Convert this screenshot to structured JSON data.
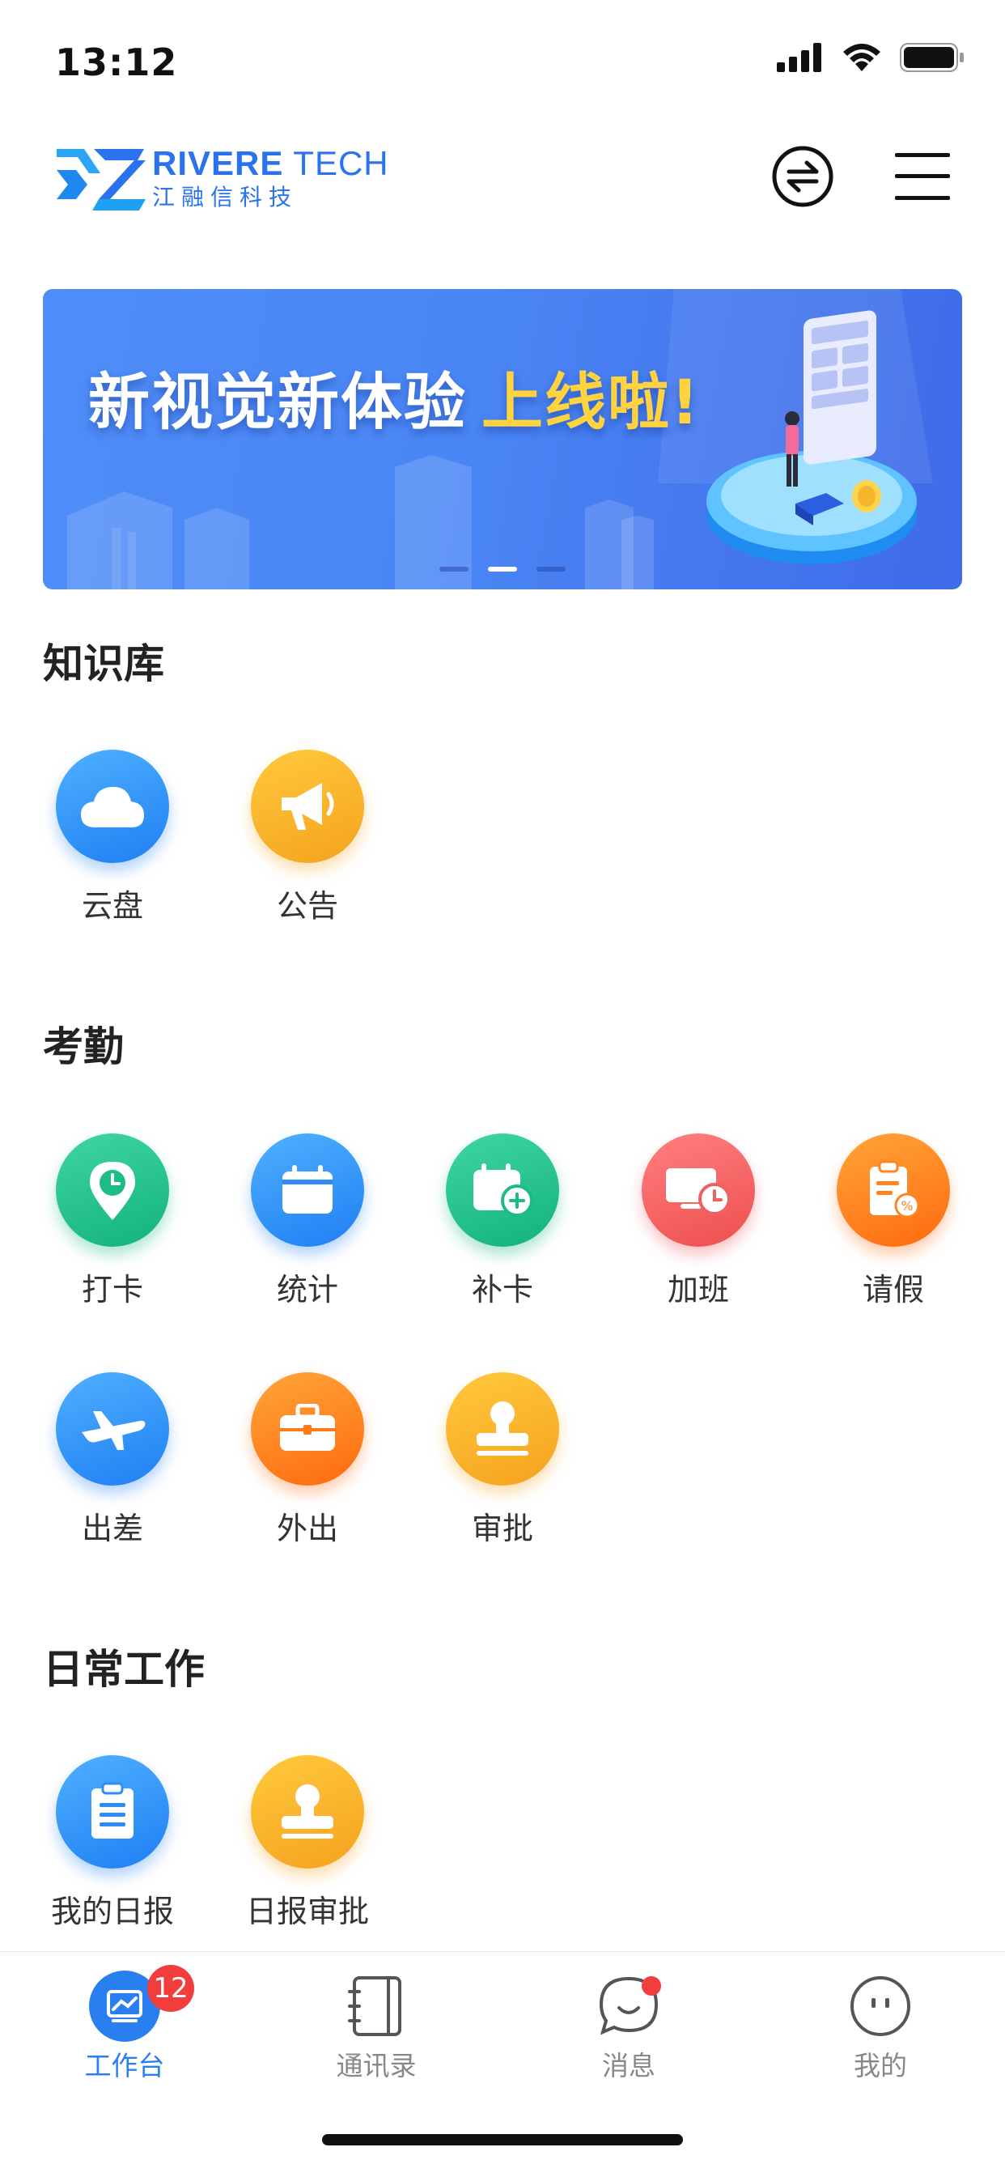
{
  "status_bar": {
    "time": "13:12"
  },
  "header": {
    "logo_en_bold": "RIVERE",
    "logo_en_rest": " TECH",
    "logo_cn": "江融信科技",
    "brand_color": "#2a72ee",
    "icons": [
      "swap-icon",
      "menu-icon"
    ]
  },
  "banner": {
    "title_main": "新视觉新体验",
    "title_accent": "上线啦!",
    "slides": 3,
    "active_slide": 2
  },
  "sections": {
    "knowledge": {
      "title": "知识库",
      "items": [
        {
          "label": "云盘",
          "icon": "cloud-icon",
          "color": "blue"
        },
        {
          "label": "公告",
          "icon": "megaphone-icon",
          "color": "yellow"
        }
      ]
    },
    "attendance": {
      "title": "考勤",
      "items": [
        {
          "label": "打卡",
          "icon": "location-clock-icon",
          "color": "green"
        },
        {
          "label": "统计",
          "icon": "calendar-icon",
          "color": "blue"
        },
        {
          "label": "补卡",
          "icon": "calendar-add-icon",
          "color": "green"
        },
        {
          "label": "加班",
          "icon": "monitor-clock-icon",
          "color": "red"
        },
        {
          "label": "请假",
          "icon": "clipboard-icon",
          "color": "orange"
        },
        {
          "label": "出差",
          "icon": "airplane-icon",
          "color": "blue"
        },
        {
          "label": "外出",
          "icon": "briefcase-icon",
          "color": "orange"
        },
        {
          "label": "审批",
          "icon": "stamp-icon",
          "color": "yellow"
        }
      ]
    },
    "daily": {
      "title": "日常工作",
      "items": [
        {
          "label": "我的日报",
          "icon": "report-icon",
          "color": "blue"
        },
        {
          "label": "日报审批",
          "icon": "stamp-icon",
          "color": "yellow"
        }
      ]
    }
  },
  "tabbar": {
    "tabs": [
      {
        "label": "工作台",
        "icon": "workbench-icon",
        "active": true,
        "badge": "12"
      },
      {
        "label": "通讯录",
        "icon": "contacts-book-icon",
        "active": false
      },
      {
        "label": "消息",
        "icon": "message-bubble-icon",
        "active": false,
        "dot": true
      },
      {
        "label": "我的",
        "icon": "profile-face-icon",
        "active": false
      }
    ],
    "active_color": "#2a7ff0"
  }
}
